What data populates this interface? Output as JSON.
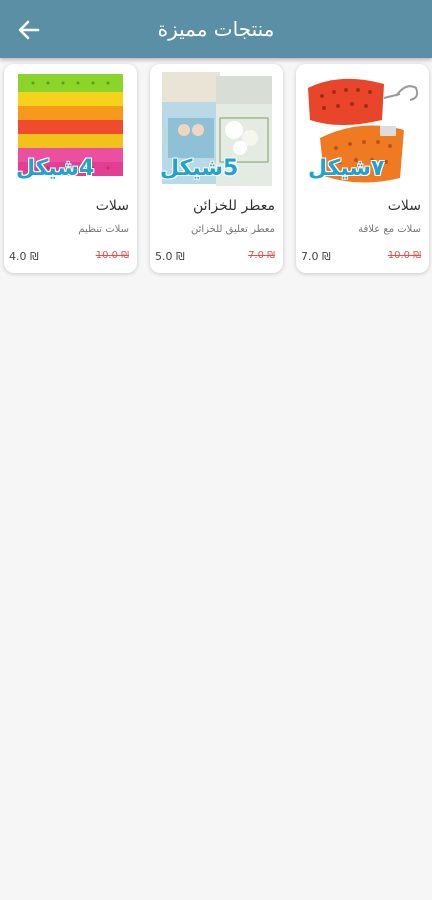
{
  "appbar": {
    "title": "منتجات مميزة",
    "back_icon": "arrow-back-icon",
    "background_color": "#5b8fa6"
  },
  "products": [
    {
      "promo": "4شيكل",
      "name": "سلات",
      "description": "سلات تنظيم",
      "price": "4.0 ₪",
      "old_price": "10.0 ₪"
    },
    {
      "promo": "5شيكل",
      "name": "معطر للخزائن",
      "description": "معطر تعليق للخزائن",
      "price": "5.0 ₪",
      "old_price": "7.0 ₪"
    },
    {
      "promo": "٧شيكل",
      "name": "سلات",
      "description": "سلات مع علاقة",
      "price": "7.0 ₪",
      "old_price": "10.0 ₪"
    }
  ],
  "colors": {
    "promo_text": "#1fa3cf",
    "old_price": "#d9534f"
  }
}
